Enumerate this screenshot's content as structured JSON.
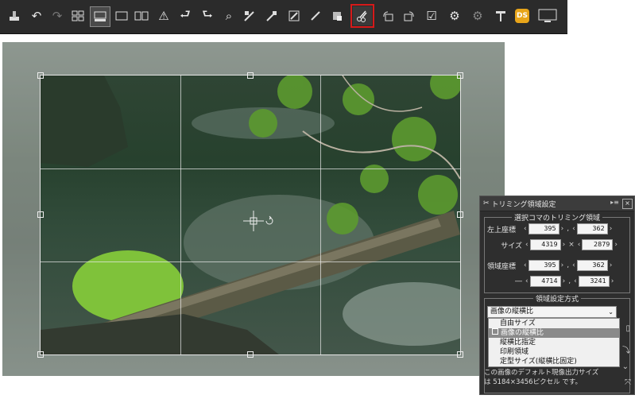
{
  "toolbar": {
    "icons": [
      "stamp-icon",
      "undo-icon",
      "redo-icon",
      "grid-view-icon",
      "filmstrip-view-icon",
      "single-view-icon",
      "compare-view-icon",
      "warning-icon",
      "previous-icon",
      "next-icon",
      "zoom-icon",
      "tool-a-icon",
      "tool-b-icon",
      "tool-c-icon",
      "brush-icon",
      "eraser-icon",
      "trim-icon",
      "rotate-left-icon",
      "rotate-right-icon",
      "check-icon",
      "settings-a-icon",
      "settings-b-icon",
      "hammer-icon",
      "ds-icon",
      "monitor-icon"
    ],
    "ds_label": "DS"
  },
  "panel": {
    "title": "トリミング領域設定",
    "section1": {
      "heading": "選択コマのトリミング領域",
      "top_left_label": "左上座標",
      "top_left_x": "395",
      "top_left_y": "362",
      "size_label": "サイズ",
      "size_w": "4319",
      "size_h": "2879",
      "region_label": "領域座標",
      "region_x1": "395",
      "region_y1": "362",
      "region_sep": "―",
      "region_x2": "4714",
      "region_y2": "3241",
      "times": "×",
      "comma": ","
    },
    "section2": {
      "heading": "領域設定方式",
      "selected": "画像の縦横比",
      "options": [
        "自由サイズ",
        "画像の縦横比",
        "縦横比指定",
        "印刷領域",
        "定型サイズ(縦横比固定)"
      ]
    },
    "note_line1": "この画像のデフォルト現像出力サイズ",
    "note_line2": "は 5184×3456ピクセル です。"
  },
  "colors": {
    "toolbar_bg": "#2b2b2b",
    "highlight": "#d61a1a",
    "panel_bg": "#2e2e2e"
  }
}
